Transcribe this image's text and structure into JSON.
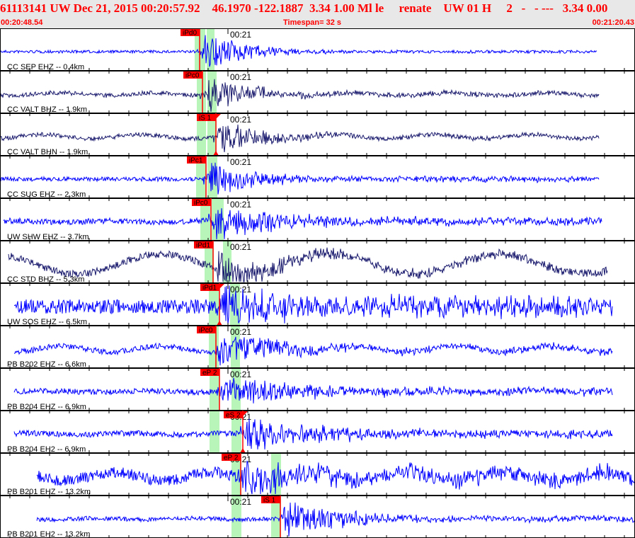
{
  "header": {
    "title": "61113141 UW Dec 21, 2015 00:20:57.92    46.1970 -122.1887  3.34 1.00 Ml le     renate    UW 01 H     2   -   - ---   3.34 0.00",
    "start_time": "00:20:48.54",
    "timespan": "Timespan=  32 s",
    "end_time": "00:21:20.43"
  },
  "minute_label": "00:21",
  "colors": {
    "pick": "#ff0000",
    "window": "#b8f5b8",
    "trace_blue": "#0000ff",
    "trace_navy": "#1a1a6e",
    "header_text": "#ff0000"
  },
  "panels": [
    {
      "label": "CC SEP EHZ -- 0.4km",
      "pick": "iPd0"
    },
    {
      "label": "CC VALT BHZ -- 1.9km",
      "pick": "iPc0"
    },
    {
      "label": "CC VALT BHN -- 1.9km",
      "pick": "iS 1"
    },
    {
      "label": "CC SUG EHZ -- 2.3km",
      "pick": "iPc1"
    },
    {
      "label": "UW SHW EHZ -- 3.7km",
      "pick": "iPc0"
    },
    {
      "label": "CC STD BHZ -- 5.3km",
      "pick": "iPd1"
    },
    {
      "label": "UW SOS EHZ -- 6.5km",
      "pick": "iPd1"
    },
    {
      "label": "PB B202 EHZ -- 6.6km",
      "pick": "iPc0"
    },
    {
      "label": "PB B204 EHZ -- 6.9km",
      "pick": "eP 2"
    },
    {
      "label": "PB B204 EH2 -- 6.9km",
      "pick": "eS 2"
    },
    {
      "label": "PB B201 EHZ -- 13.2km",
      "pick": "eP 2"
    },
    {
      "label": "PB B201 EH2 -- 13.2km",
      "pick": "iS 1"
    }
  ]
}
